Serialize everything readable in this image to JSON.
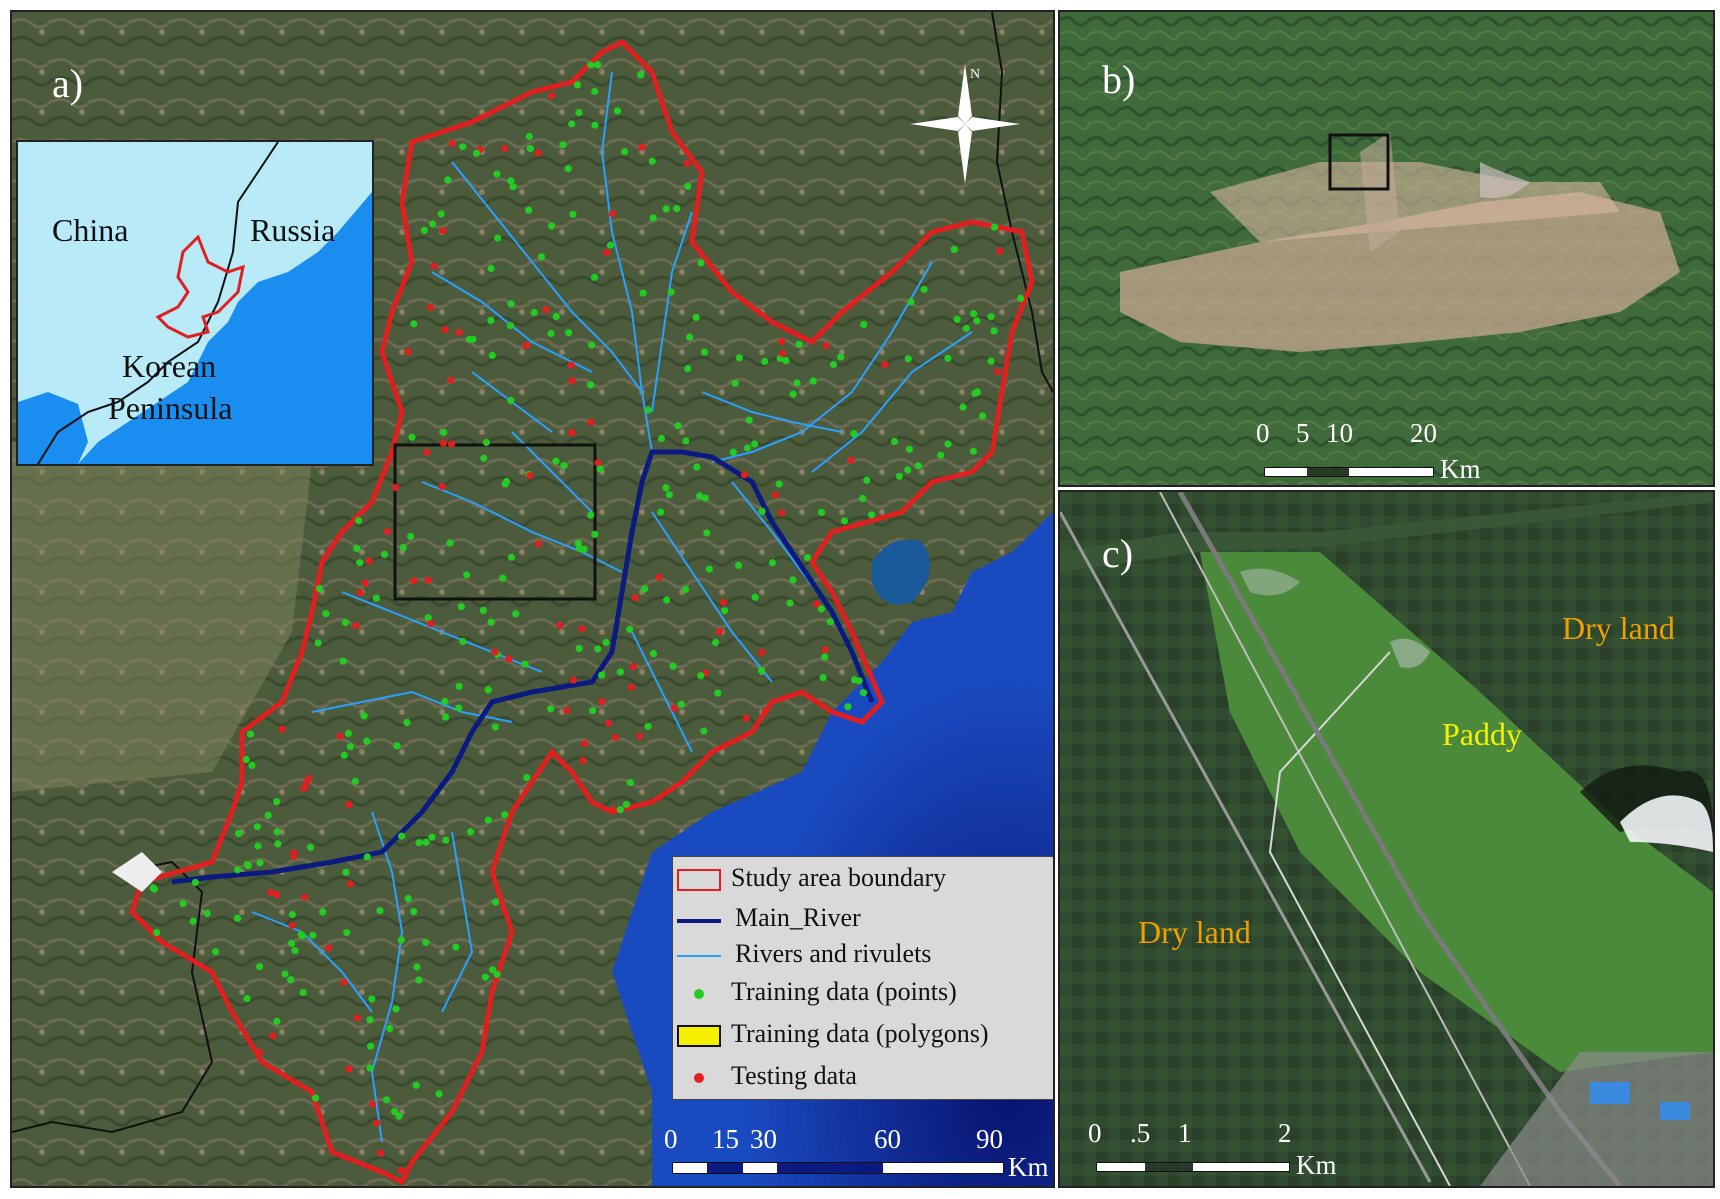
{
  "panels": {
    "a": {
      "label": "a)",
      "inset": {
        "country_labels": [
          "China",
          "Russia",
          "Korean",
          "Peninsula"
        ]
      },
      "legend": {
        "items": [
          {
            "label": "Study area boundary",
            "symbol": "red-outline-box",
            "color": "#e02020"
          },
          {
            "label": "Main_River",
            "symbol": "line",
            "color": "#0a1a80"
          },
          {
            "label": "Rivers and rivulets",
            "symbol": "line",
            "color": "#2aa0ff"
          },
          {
            "label": "Training data (points)",
            "symbol": "dot",
            "color": "#22cc22"
          },
          {
            "label": "Training data (polygons)",
            "symbol": "yellow-box",
            "color": "#f5f000"
          },
          {
            "label": "Testing data",
            "symbol": "dot",
            "color": "#e02020"
          }
        ]
      },
      "scale_bar": {
        "ticks": [
          "0",
          "15",
          "30",
          "60",
          "90"
        ],
        "unit": "Km"
      },
      "north_arrow": "north-arrow-icon"
    },
    "b": {
      "label": "b)",
      "scale_bar": {
        "ticks": [
          "0",
          "5",
          "10",
          "20"
        ],
        "unit": "Km"
      }
    },
    "c": {
      "label": "c)",
      "land_cover_labels": [
        {
          "text": "Dry land",
          "color": "#f0a000"
        },
        {
          "text": "Paddy",
          "color": "#f5f000"
        },
        {
          "text": "Dry land",
          "color": "#f0a000"
        }
      ],
      "scale_bar": {
        "ticks": [
          "0",
          ".5",
          "1",
          "2"
        ],
        "unit": "Km"
      }
    }
  },
  "colors": {
    "boundary": "#e02020",
    "main_river": "#0a1a80",
    "rivers": "#2aa0ff",
    "training_points": "#22cc22",
    "testing_points": "#e02020",
    "sea": "#0a2a9a",
    "land": "#4a5a38"
  }
}
